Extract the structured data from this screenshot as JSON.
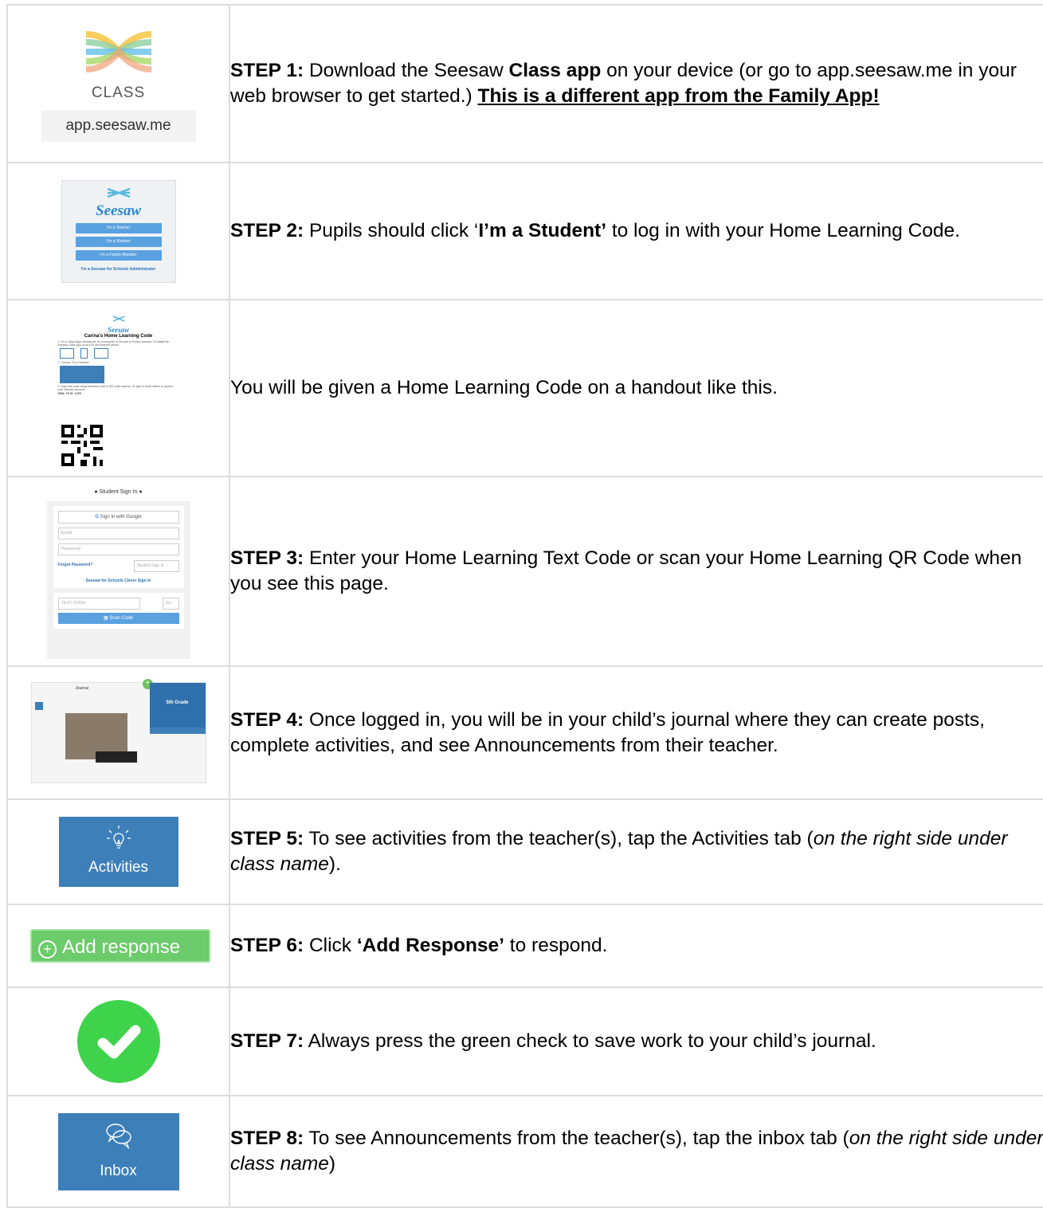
{
  "row1": {
    "logo_word": "CLASS",
    "url": "app.seesaw.me",
    "step_label": "STEP 1:",
    "text_a": " Download the Seesaw ",
    "text_b": "Class app",
    "text_c": " on your device (or go to app.seesaw.me in your web browser to get started.) ",
    "text_d": "This is a different app from the Family App!"
  },
  "row2": {
    "card_logo": "Seesaw",
    "btn_teacher": "I'm a Teacher",
    "btn_student": "I'm a Student",
    "btn_family": "I'm a Family Member",
    "admin_link": "I'm a Seesaw for Schools Administrator",
    "step_label": "STEP 2:",
    "text_a": " Pupils should click ‘",
    "text_b": "I’m a Student’",
    "text_c": " to log in with your Home Learning Code."
  },
  "row3": {
    "handout_logo": "Seesaw",
    "handout_title": "Carina's Home Learning Code",
    "handout_step1": "1. Go to https://app.seesaw.me on a computer in Chrome or Firefox browser. Or install the Seesaw Class App on an iOS and Android device.",
    "handout_step2": "2. Choose \"I'm a Student\"",
    "handout_step3": "3. Scan this code using Seesaw's built-in QR code scanner. Or type in these letters to access your Seesaw account:",
    "handout_code": "OBNA FP1R 15P0",
    "text": "You will be given  a Home Learning Code on a handout like this."
  },
  "row4": {
    "header": "Student Sign In",
    "google": "Sign In with Google",
    "email": "Email",
    "password": "Password",
    "forgot": "Forgot Password?",
    "signin_btn": "Student Sign In",
    "clever": "Seesaw for Schools Clever Sign In",
    "text_code": "TEXT CODE",
    "go": "Go",
    "scan": "Scan Code",
    "step_label": "STEP 3:",
    "text": " Enter your Home Learning Text Code or scan your Home Learning QR Code when you see this page."
  },
  "row5": {
    "journal_title": "Journal",
    "class_name": "5th Grade",
    "step_label": "STEP 4:",
    "text": " Once logged in, you will be in your child’s journal where they can create posts, complete activities, and see Announcements from their teacher."
  },
  "row6": {
    "tile_label": "Activities",
    "step_label": "STEP 5:",
    "text_a": " To see activities from the teacher(s), tap the Activities tab (",
    "text_b": "on the right side under class name",
    "text_c": ")."
  },
  "row7": {
    "btn_label": "Add response",
    "step_label": "STEP 6:",
    "text_a": " Click ",
    "text_b": "‘Add Response’",
    "text_c": " to respond."
  },
  "row8": {
    "step_label": "STEP 7:",
    "text": " Always press the green check to save work to your child’s journal."
  },
  "row9": {
    "tile_label": "Inbox",
    "step_label": "STEP 8:",
    "text_a": " To see Announcements from the teacher(s), tap the inbox tab (",
    "text_b": "on the right side under class name",
    "text_c": ")"
  },
  "colors": {
    "seesaw_blue": "#3d7fb9",
    "check_green": "#3fd34b",
    "add_response_green": "#6ccb6a",
    "grid_line": "#dcdcdc"
  }
}
